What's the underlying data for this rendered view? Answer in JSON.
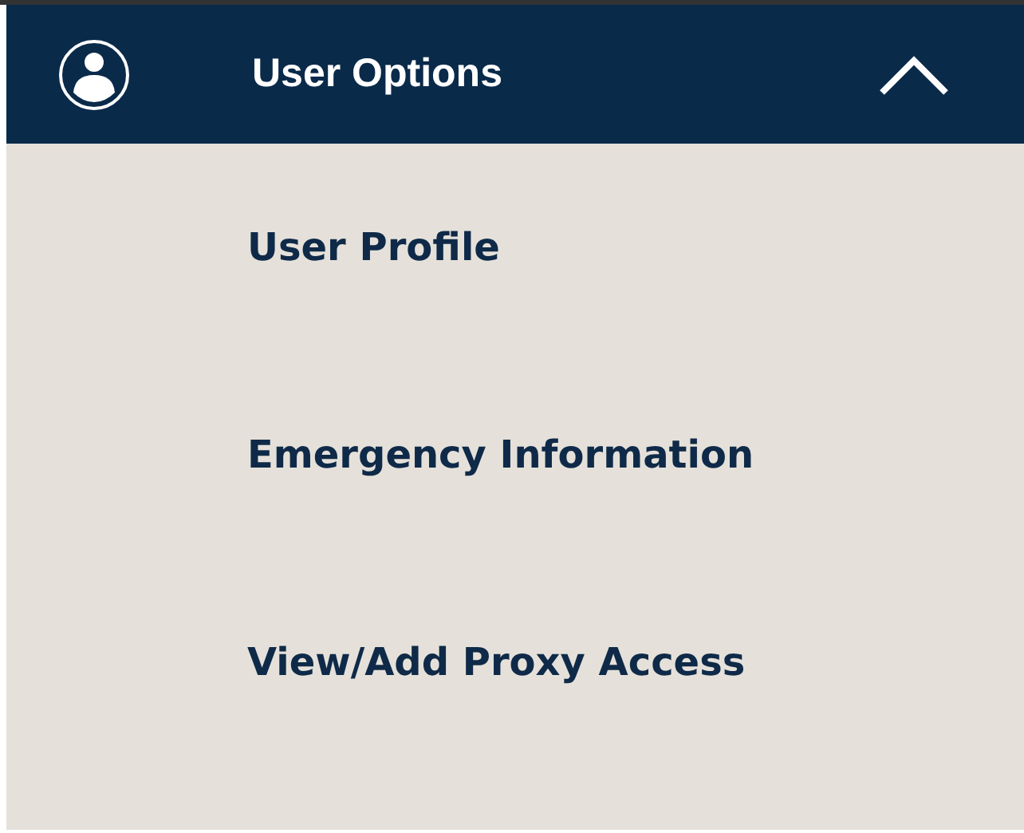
{
  "menu": {
    "title": "User Options",
    "expanded": true,
    "items": [
      {
        "label": "User Profile"
      },
      {
        "label": "Emergency Information"
      },
      {
        "label": "View/Add Proxy Access"
      }
    ]
  }
}
